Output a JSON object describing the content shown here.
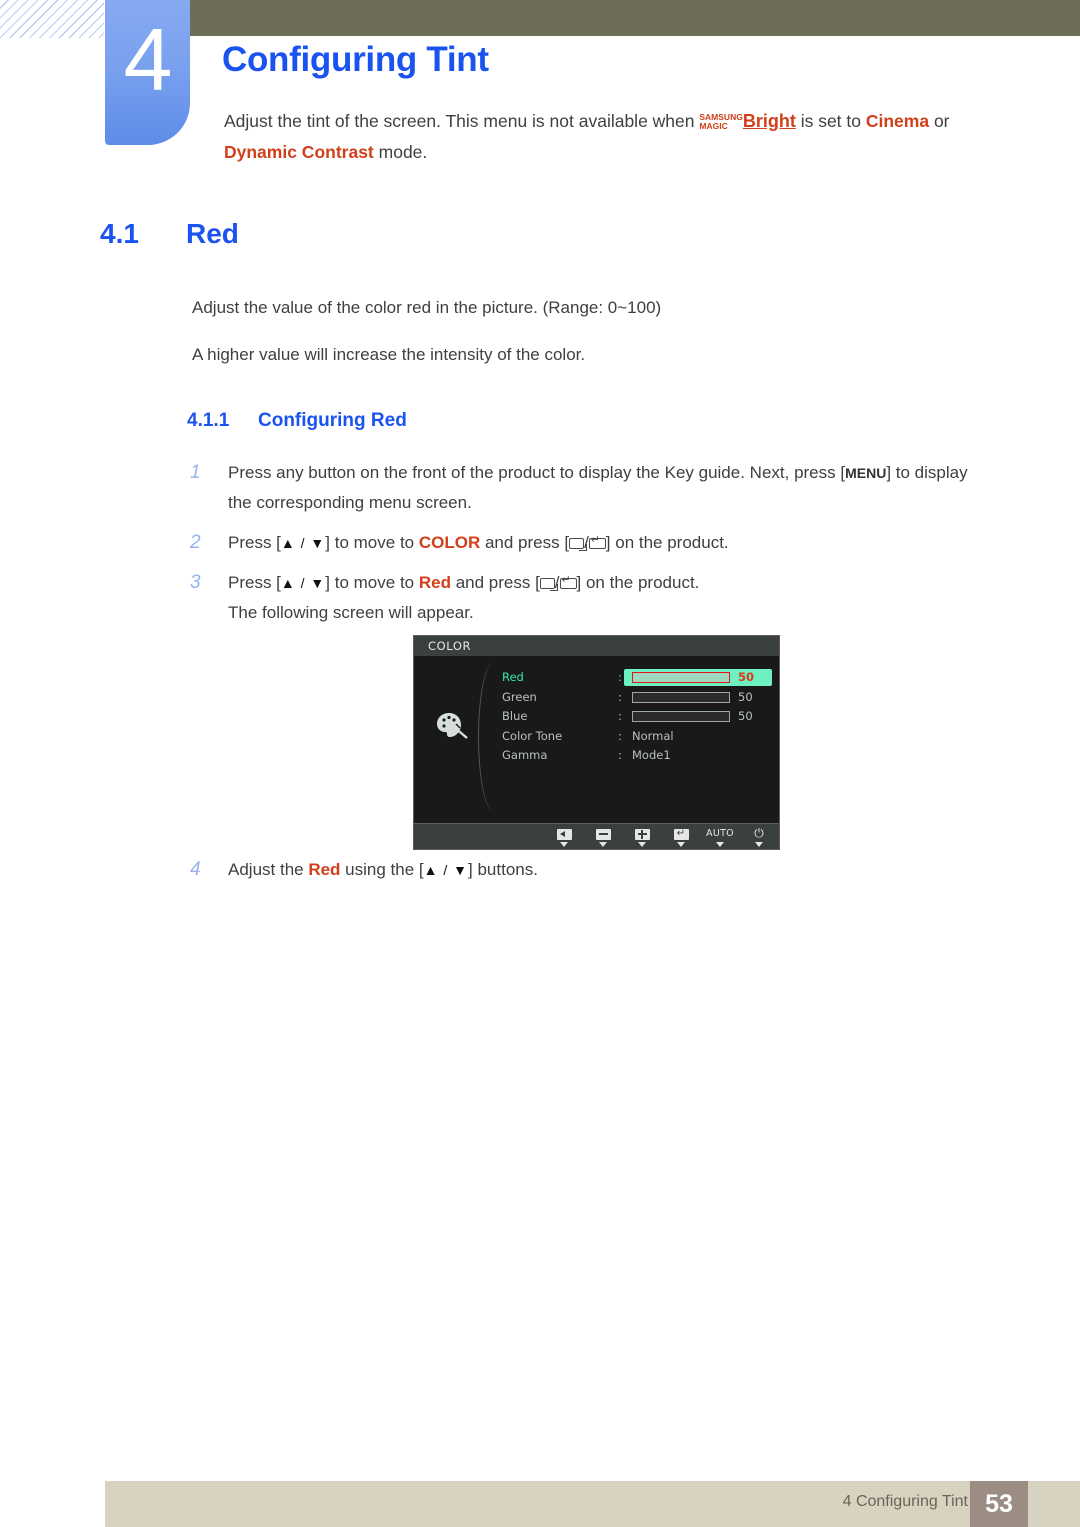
{
  "header": {
    "chapter_number": "4",
    "chapter_title": "Configuring Tint",
    "intro_part1": "Adjust the tint of the screen. This menu is not available when ",
    "magic_line1": "SAMSUNG",
    "magic_line2": "MAGIC",
    "magic_bright": "Bright",
    "intro_part2": " is set to ",
    "term_cinema": "Cinema",
    "intro_part3": " or ",
    "term_dynamic_contrast": "Dynamic Contrast",
    "intro_part4": " mode."
  },
  "section": {
    "number": "4.1",
    "title": "Red",
    "paragraph1": "Adjust the value of the color red in the picture. (Range: 0~100)",
    "paragraph2": "A higher value will increase the intensity of the color."
  },
  "subsection": {
    "number": "4.1.1",
    "title": "Configuring Red"
  },
  "steps": [
    {
      "number": "1",
      "text_a": "Press any button on the front of the product to display the Key guide. Next, press [",
      "key": "MENU",
      "text_b": "] to display",
      "line2": "the corresponding menu screen."
    },
    {
      "number": "2",
      "text_a": "Press [",
      "arrows": "▲ / ▼",
      "text_b": "] to move to ",
      "target": "COLOR",
      "text_c": " and press [",
      "text_d": "] on the product."
    },
    {
      "number": "3",
      "text_a": "Press [",
      "arrows": "▲ / ▼",
      "text_b": "] to move to ",
      "target": "Red",
      "text_c": " and press [",
      "text_d": "] on the product.",
      "line2": "The following screen will appear."
    },
    {
      "number": "4",
      "text_a": "Adjust the ",
      "target": "Red",
      "text_b": " using the [",
      "arrows": "▲ / ▼",
      "text_c": "] buttons."
    }
  ],
  "osd": {
    "title": "COLOR",
    "icon": "palette-icon",
    "rows": [
      {
        "label": "Red",
        "colon": ":",
        "type": "slider",
        "value": "50",
        "fill_percent": 50,
        "active": true
      },
      {
        "label": "Green",
        "colon": ":",
        "type": "slider",
        "value": "50",
        "fill_percent": 50,
        "active": false
      },
      {
        "label": "Blue",
        "colon": ":",
        "type": "slider",
        "value": "50",
        "fill_percent": 50,
        "active": false
      },
      {
        "label": "Color Tone",
        "colon": ":",
        "type": "text",
        "value": "Normal",
        "active": false
      },
      {
        "label": "Gamma",
        "colon": ":",
        "type": "text",
        "value": "Mode1",
        "active": false
      }
    ],
    "keys": [
      {
        "name": "left-arrow-key",
        "glyph": "box-left",
        "label": ""
      },
      {
        "name": "minus-key",
        "glyph": "box-minus",
        "label": ""
      },
      {
        "name": "plus-key",
        "glyph": "box-plus",
        "label": ""
      },
      {
        "name": "enter-key",
        "glyph": "box-enter",
        "label": ""
      },
      {
        "name": "auto-key",
        "glyph": "text",
        "label": "AUTO"
      },
      {
        "name": "power-key",
        "glyph": "power",
        "label": "⏻"
      }
    ]
  },
  "footer": {
    "text": "4 Configuring Tint",
    "page": "53"
  },
  "colors": {
    "accent_blue": "#1a53f0",
    "accent_red": "#d1401b",
    "olive": "#6d6d58",
    "footer_bg": "#d8d3c0",
    "page_badge": "#9b8d84",
    "osd_highlight": "#6ff0c0",
    "osd_active_text": "#3ae5a8"
  }
}
